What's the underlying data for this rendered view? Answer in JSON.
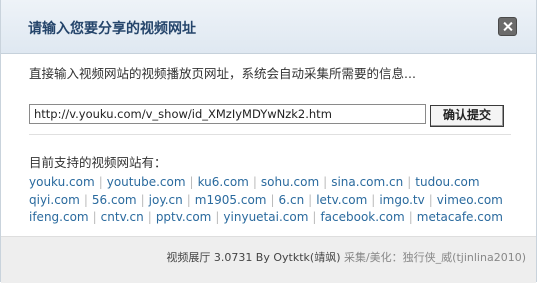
{
  "dialog": {
    "title": "请输入您要分享的视频网址",
    "description": "直接输入视频网站的视频播放页网址，系统会自动采集所需要的信息...",
    "url_input_value": "http://v.youku.com/v_show/id_XMzIyMDYwNzk2.htm",
    "submit_label": "确认提交",
    "close_icon": "close-icon",
    "support_label": "目前支持的视频网站有：",
    "site_rows": [
      [
        "youku.com",
        "youtube.com",
        "ku6.com",
        "sohu.com",
        "sina.com.cn",
        "tudou.com"
      ],
      [
        "qiyi.com",
        "56.com",
        "joy.cn",
        "m1905.com",
        "6.cn",
        "letv.com",
        "imgo.tv",
        "vimeo.com"
      ],
      [
        "ifeng.com",
        "cntv.cn",
        "pptv.com",
        "yinyuetai.com",
        "facebook.com",
        "metacafe.com"
      ]
    ]
  },
  "footer": {
    "version": "视频展厅 3.0731 By Oytktk(靖飒)",
    "credit": " 采集/美化：独行侠_威(tjinlina2010)"
  },
  "colors": {
    "title": "#25456b",
    "link": "#2a6a9e",
    "footer_bg": "#eeeeee"
  }
}
